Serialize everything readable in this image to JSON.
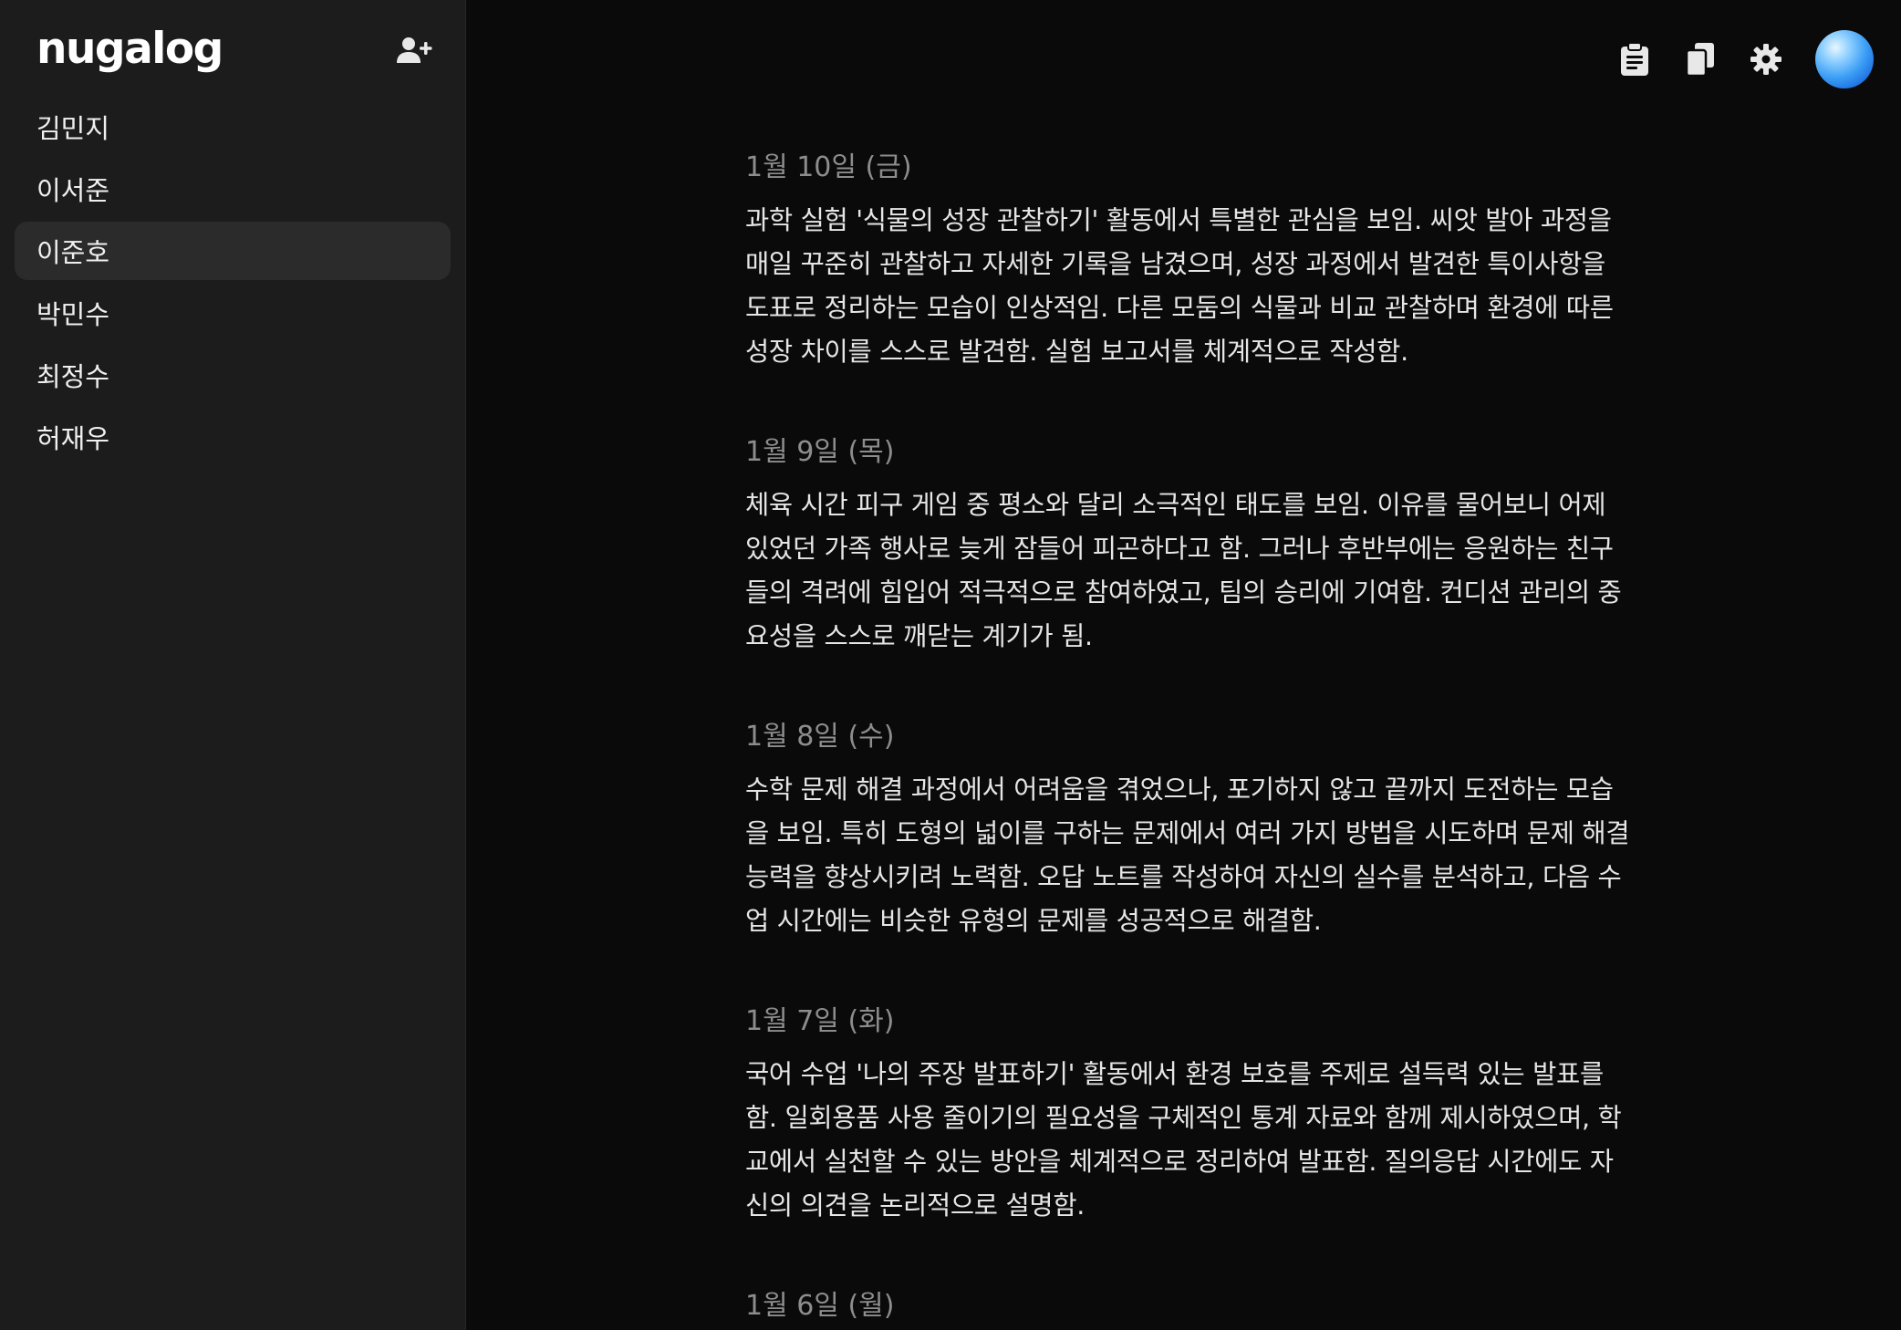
{
  "app": {
    "logo": "nugalog"
  },
  "sidebar": {
    "students": [
      {
        "name": "김민지",
        "active": false
      },
      {
        "name": "이서준",
        "active": false
      },
      {
        "name": "이준호",
        "active": true
      },
      {
        "name": "박민수",
        "active": false
      },
      {
        "name": "최정수",
        "active": false
      },
      {
        "name": "허재우",
        "active": false
      }
    ]
  },
  "topbar": {
    "icons": [
      "clipboard-icon",
      "copy-icon",
      "gear-icon",
      "avatar"
    ]
  },
  "entries": [
    {
      "date": "1월 10일 (금)",
      "text": "과학 실험 '식물의 성장 관찰하기' 활동에서 특별한 관심을 보임. 씨앗 발아 과정을 매일 꾸준히 관찰하고 자세한 기록을 남겼으며, 성장 과정에서 발견한 특이사항을 도표로 정리하는 모습이 인상적임. 다른 모둠의 식물과 비교 관찰하며 환경에 따른 성장 차이를 스스로 발견함. 실험 보고서를 체계적으로 작성함."
    },
    {
      "date": "1월 9일 (목)",
      "text": "체육 시간 피구 게임 중 평소와 달리 소극적인 태도를 보임. 이유를 물어보니 어제 있었던 가족 행사로 늦게 잠들어 피곤하다고 함. 그러나 후반부에는 응원하는 친구들의 격려에 힘입어 적극적으로 참여하였고, 팀의 승리에 기여함. 컨디션 관리의 중요성을 스스로 깨닫는 계기가 됨."
    },
    {
      "date": "1월 8일 (수)",
      "text": "수학 문제 해결 과정에서 어려움을 겪었으나, 포기하지 않고 끝까지 도전하는 모습을 보임. 특히 도형의 넓이를 구하는 문제에서 여러 가지 방법을 시도하며 문제 해결 능력을 향상시키려 노력함. 오답 노트를 작성하여 자신의 실수를 분석하고, 다음 수업 시간에는 비슷한 유형의 문제를 성공적으로 해결함."
    },
    {
      "date": "1월 7일 (화)",
      "text": "국어 수업 '나의 주장 발표하기' 활동에서 환경 보호를 주제로 설득력 있는 발표를 함. 일회용품 사용 줄이기의 필요성을 구체적인 통계 자료와 함께 제시하였으며, 학교에서 실천할 수 있는 방안을 체계적으로 정리하여 발표함. 질의응답 시간에도 자신의 의견을 논리적으로 설명함."
    },
    {
      "date": "1월 6일 (월)",
      "text": ""
    }
  ]
}
